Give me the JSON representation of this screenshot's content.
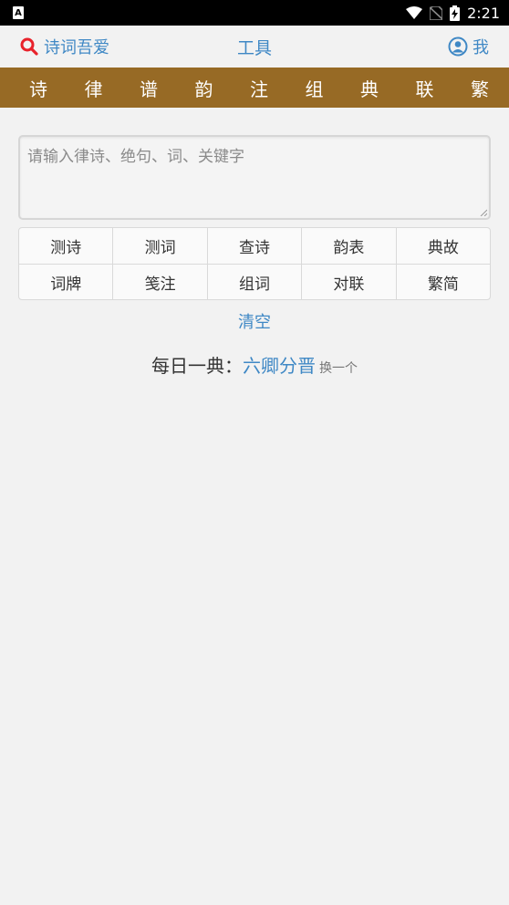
{
  "status_bar": {
    "time": "2:21"
  },
  "header": {
    "search_label": "诗词吾爱",
    "title": "工具",
    "profile_label": "我"
  },
  "nav": {
    "items": [
      "诗",
      "律",
      "谱",
      "韵",
      "注",
      "组",
      "典",
      "联",
      "繁"
    ]
  },
  "search": {
    "placeholder": "请输入律诗、绝句、词、关键字",
    "value": ""
  },
  "tools": {
    "row1": [
      "测诗",
      "测词",
      "查诗",
      "韵表",
      "典故"
    ],
    "row2": [
      "词牌",
      "笺注",
      "组词",
      "对联",
      "繁简"
    ]
  },
  "clear_label": "清空",
  "daily": {
    "label": "每日一典：",
    "term": "六卿分晋",
    "swap_label": "换一个"
  },
  "colors": {
    "accent": "#3f88c5",
    "nav_bg": "#976a25",
    "search_icon": "#e8222b",
    "page_bg": "#f2f2f2"
  }
}
